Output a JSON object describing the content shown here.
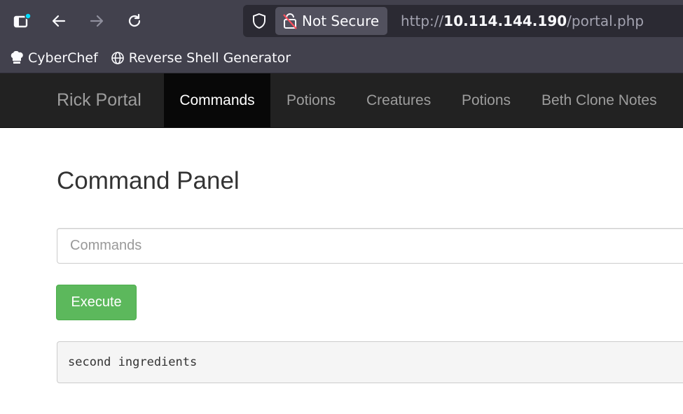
{
  "browser": {
    "security_label": "Not Secure",
    "url_scheme": "http://",
    "url_host": "10.114.144.190",
    "url_path": "/portal.php",
    "bookmarks": [
      {
        "label": "CyberChef",
        "icon": "chef-hat-icon"
      },
      {
        "label": "Reverse Shell Generator",
        "icon": "globe-icon"
      }
    ]
  },
  "navbar": {
    "brand": "Rick Portal",
    "items": [
      {
        "label": "Commands",
        "active": true
      },
      {
        "label": "Potions",
        "active": false
      },
      {
        "label": "Creatures",
        "active": false
      },
      {
        "label": "Potions",
        "active": false
      },
      {
        "label": "Beth Clone Notes",
        "active": false
      }
    ]
  },
  "main": {
    "title": "Command Panel",
    "command_input": {
      "placeholder": "Commands",
      "value": ""
    },
    "execute_label": "Execute",
    "output": "second ingredients"
  },
  "colors": {
    "navbar_bg": "#222222",
    "nav_active_bg": "#080808",
    "execute_green": "#5cb85c",
    "chrome_bg": "#42414d"
  }
}
